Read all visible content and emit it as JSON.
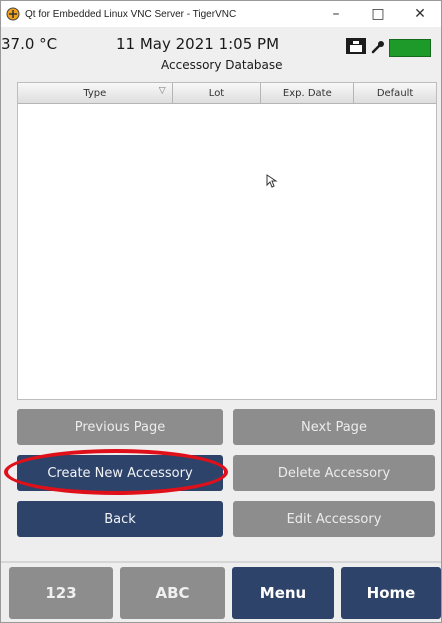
{
  "window": {
    "title": "Qt for Embedded Linux VNC Server - TigerVNC",
    "minimize": "–",
    "maximize": "□",
    "close": "✕"
  },
  "status": {
    "temperature": "37.0 °C",
    "datetime": "11 May 2021 1:05 PM",
    "screen_title": "Accessory Database"
  },
  "table": {
    "columns": [
      "Type",
      "Lot",
      "Exp. Date",
      "Default"
    ],
    "rows": []
  },
  "buttons": {
    "previous_page": "Previous Page",
    "next_page": "Next Page",
    "create_new_accessory": "Create New Accessory",
    "delete_accessory": "Delete Accessory",
    "back": "Back",
    "edit_accessory": "Edit Accessory"
  },
  "bottom_bar": {
    "numeric": "123",
    "alpha": "ABC",
    "menu": "Menu",
    "home": "Home"
  },
  "colors": {
    "navy": "#2e4369",
    "gray": "#8d8d8d",
    "battery": "#1e9a2a",
    "highlight": "#e0101a"
  }
}
